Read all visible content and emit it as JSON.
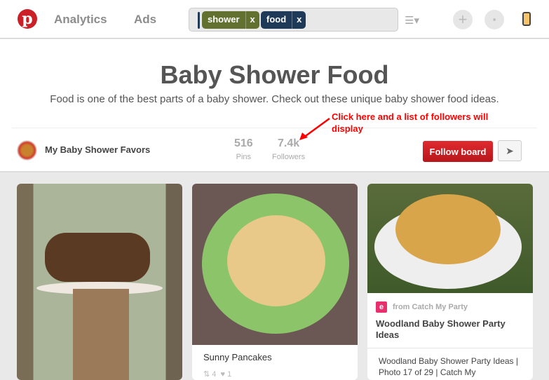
{
  "nav": {
    "logo": "p",
    "analytics": "Analytics",
    "ads": "Ads"
  },
  "search": {
    "tags": [
      {
        "label": "shower",
        "color": "#627030"
      },
      {
        "label": "food",
        "color": "#1f3a58"
      }
    ],
    "remove": "x"
  },
  "icons": {
    "add": "+",
    "messages": "speech-bubble-icon",
    "notifications": "lightbulb-icon",
    "view": "list-view-icon"
  },
  "board": {
    "title": "Baby Shower Food",
    "description": "Food is one of the best parts of a baby shower. Check out these unique baby shower food ideas.",
    "owner": "My Baby Shower Favors",
    "pins_count": "516",
    "pins_label": "Pins",
    "followers_count": "7.4k",
    "followers_label": "Followers",
    "follow_button": "Follow board",
    "send_icon": "➤"
  },
  "annotation": "Click here and a list of followers will display",
  "pins": [
    {
      "title": ""
    },
    {
      "title": "Sunny Pancakes",
      "repins": "4",
      "likes": "1"
    },
    {
      "source": "from Catch My Party",
      "title": "Woodland Baby Shower Party Ideas",
      "description": "Woodland Baby Shower Party Ideas | Photo 17 of 29 | Catch My"
    }
  ]
}
